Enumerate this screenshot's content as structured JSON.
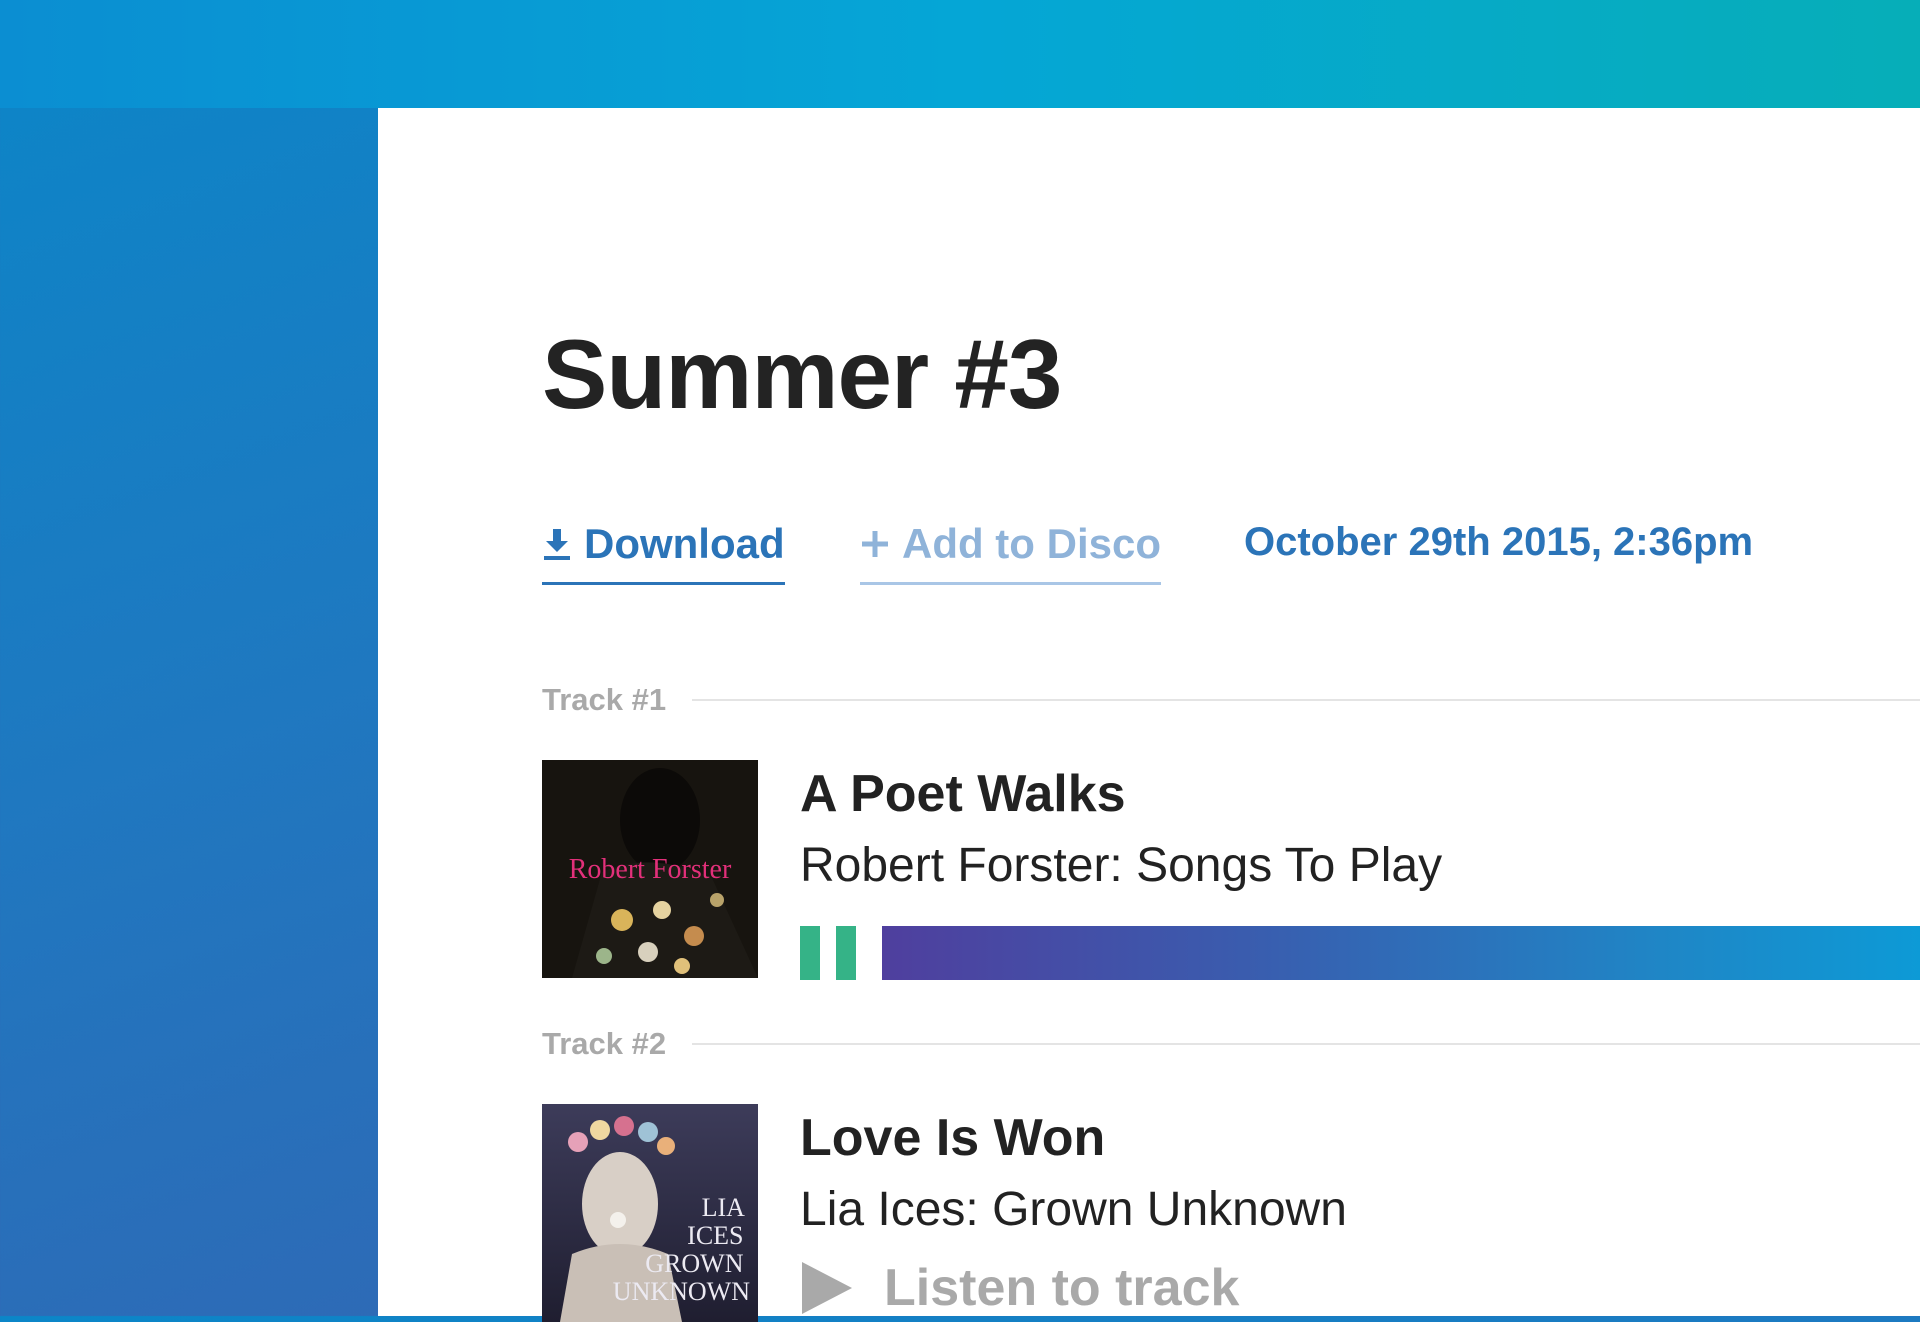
{
  "playlist": {
    "title": "Summer #3",
    "actions": {
      "download_label": "Download",
      "add_label": "Add to Disco",
      "date": "October 29th 2015, 2:36pm"
    }
  },
  "tracks": [
    {
      "label": "Track #1",
      "title": "A Poet Walks",
      "subtitle": "Robert Forster: Songs To Play",
      "cover_text": "Robert Forster",
      "state": "playing",
      "progress": 1.0
    },
    {
      "label": "Track #2",
      "title": "Love Is Won",
      "subtitle": "Lia Ices: Grown Unknown",
      "cover_text": [
        "LIA",
        "ICES",
        "GROWN",
        "UNKNOWN"
      ],
      "listen_label": "Listen to track"
    }
  ],
  "colors": {
    "accent": "#2b74b8",
    "accent_light": "#8fb3d9",
    "pause": "#35b387",
    "muted": "#a9a9a9"
  },
  "icons": {
    "download": "download-icon",
    "add": "plus-icon",
    "pause": "pause-icon",
    "play": "play-icon"
  }
}
